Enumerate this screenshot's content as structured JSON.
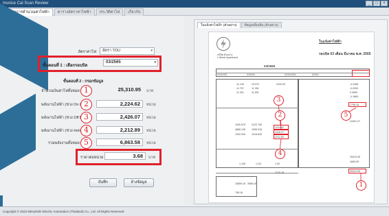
{
  "window": {
    "title": "Invoice Cal Scan Review",
    "buttons": [
      "_",
      "□",
      "×"
    ]
  },
  "tabs": [
    "สรุปผลการคำนวณค่าไฟฟ้า",
    "ตารางอัตราค่าไฟฟ้า",
    "ประวัติค่าไฟ",
    "เกี่ยวกับ"
  ],
  "form": {
    "tariff_label": "อัตราค่าไฟ",
    "tariff_value": "อัตรา TOU",
    "step1_label": "ขั้นตอนที่ 1 : เลือกรอบบิล",
    "step1_value": "03/2565",
    "step2_label": "ขั้นตอนที่ 2 : กรอกข้อมูล",
    "rows": [
      {
        "label": "จำนวนเงินค่าไฟทั้งหมด",
        "value": "25,310.95",
        "unit": "บาท",
        "num": "1"
      },
      {
        "label": "พลังงานไฟฟ้า (ช่วง On Peak)",
        "value": "2,224.62",
        "unit": "หน่วย",
        "num": "2"
      },
      {
        "label": "พลังงานไฟฟ้า (ช่วง Off Peak)",
        "value": "2,426.07",
        "unit": "หน่วย",
        "num": "3"
      },
      {
        "label": "พลังงานไฟฟ้า (ช่วง Holiday)",
        "value": "2,212.89",
        "unit": "หน่วย",
        "num": "4"
      },
      {
        "label": "รวมพลังงานทั้งหมด",
        "value": "6,863.58",
        "unit": "หน่วย",
        "num": "5"
      }
    ],
    "unit_price_label": "ราคาต่อหน่วย",
    "unit_price_value": "3.68",
    "unit_price_unit": "บาท",
    "save_button": "บันทึก",
    "clear_button": "ล้างข้อมูล"
  },
  "right_panel": {
    "tabs": [
      "ใบแจ้งค่าไฟฟ้า (ตัวอย่าง)",
      "ข้อมูลเพิ่มเติม (ตัวอย่าง)"
    ],
    "doc_title": "ใบแจ้งค่าไฟฟ้า",
    "doc_month": "รอบบิล 03 เดือน มีนาคม พ.ศ. 2565",
    "doc_customer": "บริษัท ตัวอย่าง",
    "doc_address": "x Street Apartment",
    "doc_bill_no": "03/2565",
    "doc_row_codes": [
      "XXXXXX",
      "XXXXX",
      "XXXXXXX",
      "XXXX"
    ],
    "doc_values": [
      "11.128",
      "10.970",
      "2243.00",
      "11.797",
      "11.351",
      "11.931",
      "11.591"
    ],
    "doc_values2": [
      "1099.578",
      "3122.750",
      "2224.62",
      "4866.128",
      "1006.318",
      "2426.07",
      "1302.000",
      "1018.840",
      "2212.89"
    ],
    "doc_right_values": [
      "-0.2458",
      "-0.0000",
      "0.3599",
      "-0.1860",
      "1798.16",
      "24401.27",
      "25315.95",
      "1655.95",
      "25310.95"
    ],
    "doc_bottom_values": [
      "1.128",
      "1.111",
      "1.00",
      "3775.78",
      "24859.16",
      "3985.16",
      "798.16"
    ],
    "circle_nums": [
      "1",
      "2",
      "3",
      "4",
      "5"
    ]
  },
  "footer": {
    "copyright": "Copyright © 2022 Mitsubishi Electric Automation (Thailand) Co., Ltd. All Rights Reserved"
  },
  "colors": {
    "accent_blue": "#2d6e98",
    "highlight_red": "#e0202a",
    "circle_red": "#d8202a"
  }
}
